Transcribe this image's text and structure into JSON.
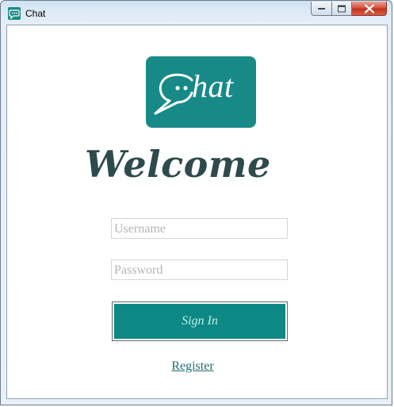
{
  "window": {
    "title": "Chat",
    "app_icon": "chat-bubble-icon",
    "buttons": {
      "minimize_icon": "minimize-icon",
      "maximize_icon": "maximize-icon",
      "close_icon": "close-icon"
    }
  },
  "logo": {
    "text": "hat",
    "icon": "speech-bubble-c-icon",
    "background_color": "#178a88"
  },
  "welcome": {
    "heading": "Welcome"
  },
  "form": {
    "username": {
      "placeholder": "Username",
      "value": ""
    },
    "password": {
      "placeholder": "Password",
      "value": ""
    },
    "signin_label": "Sign In",
    "signin_color": "#0e8884",
    "register_label": "Register"
  }
}
